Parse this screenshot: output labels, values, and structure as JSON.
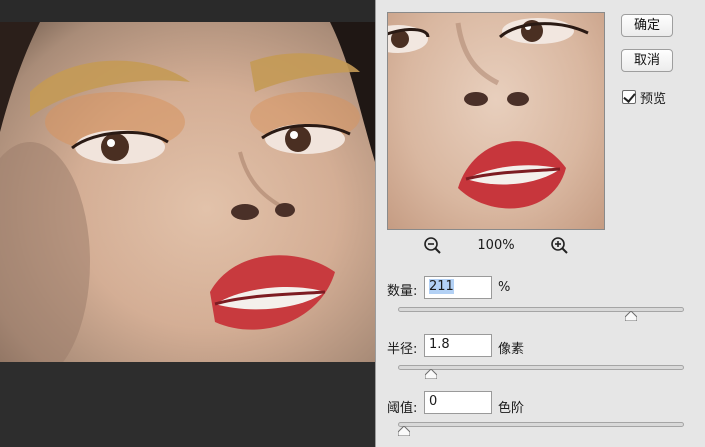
{
  "dialog": {
    "ok_label": "确定",
    "cancel_label": "取消",
    "preview_label": "预览",
    "preview_checked": true,
    "zoom_level": "100%",
    "zoom_out_icon": "zoom-out-icon",
    "zoom_in_icon": "zoom-in-icon"
  },
  "controls": {
    "amount": {
      "label": "数量:",
      "value": "211",
      "unit": "%",
      "slider_fraction": 0.83
    },
    "radius": {
      "label": "半径:",
      "value": "1.8",
      "unit": "像素",
      "slider_fraction": 0.1
    },
    "threshold": {
      "label": "阈值:",
      "value": "0",
      "unit": "色阶",
      "slider_fraction": 0.0
    }
  },
  "colors": {
    "dialog_bg": "#e6e6e6",
    "canvas_bg": "#2b2b2b",
    "selection": "#b3d1f5"
  }
}
